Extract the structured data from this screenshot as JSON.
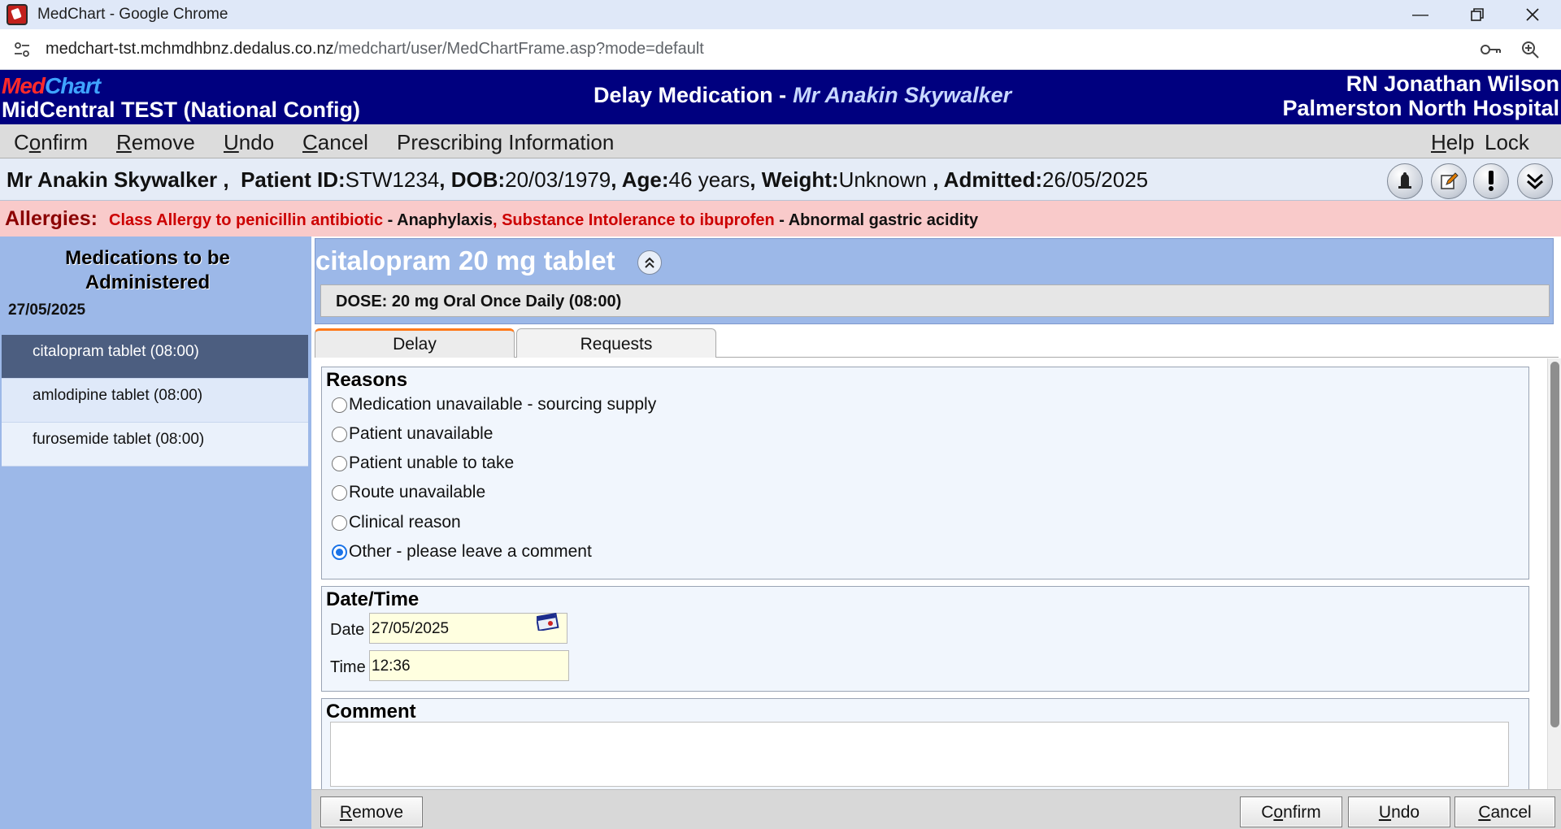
{
  "browser": {
    "window_title": "MedChart - Google Chrome",
    "url_host": "medchart-tst.mchmdhbnz.dedalus.co.nz",
    "url_path": "/medchart/user/MedChartFrame.asp?mode=default"
  },
  "header": {
    "logo_med": "Med",
    "logo_chart": "Chart",
    "org": "MidCentral TEST (National Config)",
    "screen_title": "Delay Medication -",
    "screen_patient": "Mr Anakin Skywalker",
    "user": "RN Jonathan Wilson",
    "hospital": "Palmerston North Hospital"
  },
  "menu": {
    "confirm": {
      "pre": "C",
      "ul": "o",
      "post": "nfirm"
    },
    "remove": {
      "pre": "",
      "ul": "R",
      "post": "emove"
    },
    "undo": {
      "pre": "",
      "ul": "U",
      "post": "ndo"
    },
    "cancel": {
      "pre": "",
      "ul": "C",
      "post": "ancel"
    },
    "prescribing": "Prescribing Information",
    "help": {
      "pre": "",
      "ul": "H",
      "post": "elp"
    },
    "lock": "Lock"
  },
  "patient": {
    "name": "Mr Anakin Skywalker",
    "sep": " ,",
    "id_label": "Patient ID:",
    "id": "STW1234",
    "dob_label": ", DOB:",
    "dob": "20/03/1979",
    "age_label": ", Age:",
    "age": "46 years",
    "weight_label": ", Weight:",
    "weight": "Unknown",
    "admitted_label": " , Admitted:",
    "admitted": "26/05/2025"
  },
  "allergies": {
    "label": "Allergies:",
    "a1": "Class Allergy to penicillin antibiotic",
    "r1": " - Anaphylaxis",
    "a2": ", Substance Intolerance to ibuprofen",
    "r2": " - Abnormal gastric acidity"
  },
  "left": {
    "heading_line1": "Medications to be",
    "heading_line2": "Administered",
    "date": "27/05/2025",
    "items": [
      {
        "label": "citalopram tablet (08:00)"
      },
      {
        "label": "amlodipine tablet (08:00)"
      },
      {
        "label": "furosemide tablet (08:00)"
      }
    ]
  },
  "drug": {
    "name": "citalopram 20 mg tablet",
    "dose": "DOSE: 20 mg Oral Once Daily (08:00)"
  },
  "tabs": [
    {
      "label": "Delay"
    },
    {
      "label": "Requests"
    }
  ],
  "reasons": {
    "title": "Reasons",
    "options": [
      {
        "label": "Medication unavailable - sourcing supply"
      },
      {
        "label": "Patient unavailable"
      },
      {
        "label": "Patient unable to take"
      },
      {
        "label": "Route unavailable"
      },
      {
        "label": "Clinical reason"
      },
      {
        "label": "Other - please leave a comment"
      }
    ],
    "selected": "Other - please leave a comment"
  },
  "datetime": {
    "title": "Date/Time",
    "date_label": "Date",
    "date_value": "27/05/2025",
    "time_label": "Time",
    "time_value": "12:36"
  },
  "comment": {
    "title": "Comment",
    "value": ""
  },
  "buttons": {
    "remove": {
      "pre": "",
      "ul": "R",
      "post": "emove"
    },
    "confirm": {
      "pre": "C",
      "ul": "o",
      "post": "nfirm"
    },
    "undo": {
      "pre": "",
      "ul": "U",
      "post": "ndo"
    },
    "cancel": {
      "pre": "",
      "ul": "C",
      "post": "ancel"
    }
  }
}
